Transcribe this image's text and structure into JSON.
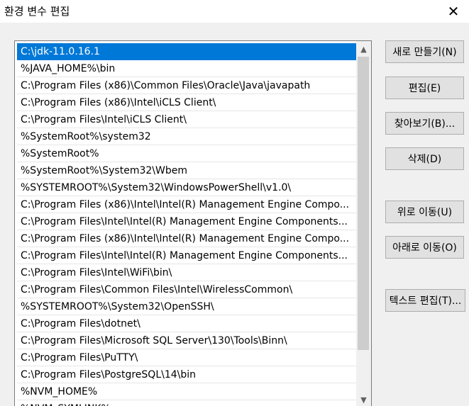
{
  "window": {
    "title": "환경 변수 편집",
    "close_glyph": "✕"
  },
  "paths": [
    "C:\\jdk-11.0.16.1",
    "%JAVA_HOME%\\bin",
    "C:\\Program Files (x86)\\Common Files\\Oracle\\Java\\javapath",
    "C:\\Program Files (x86)\\Intel\\iCLS Client\\",
    "C:\\Program Files\\Intel\\iCLS Client\\",
    "%SystemRoot%\\system32",
    "%SystemRoot%",
    "%SystemRoot%\\System32\\Wbem",
    "%SYSTEMROOT%\\System32\\WindowsPowerShell\\v1.0\\",
    "C:\\Program Files (x86)\\Intel\\Intel(R) Management Engine Compo...",
    "C:\\Program Files\\Intel\\Intel(R) Management Engine Components...",
    "C:\\Program Files (x86)\\Intel\\Intel(R) Management Engine Compo...",
    "C:\\Program Files\\Intel\\Intel(R) Management Engine Components...",
    "C:\\Program Files\\Intel\\WiFi\\bin\\",
    "C:\\Program Files\\Common Files\\Intel\\WirelessCommon\\",
    "%SYSTEMROOT%\\System32\\OpenSSH\\",
    "C:\\Program Files\\dotnet\\",
    "C:\\Program Files\\Microsoft SQL Server\\130\\Tools\\Binn\\",
    "C:\\Program Files\\PuTTY\\",
    "C:\\Program Files\\PostgreSQL\\14\\bin",
    "%NVM_HOME%",
    "%NVM_SYMLINK%"
  ],
  "selected_index": 0,
  "buttons": {
    "new": "새로 만들기(N)",
    "edit": "편집(E)",
    "browse": "찾아보기(B)...",
    "delete": "삭제(D)",
    "move_up": "위로 이동(U)",
    "move_down": "아래로 이동(O)",
    "edit_text": "텍스트 편집(T)..."
  },
  "scrollbar": {
    "up_glyph": "▲",
    "down_glyph": "▼"
  }
}
